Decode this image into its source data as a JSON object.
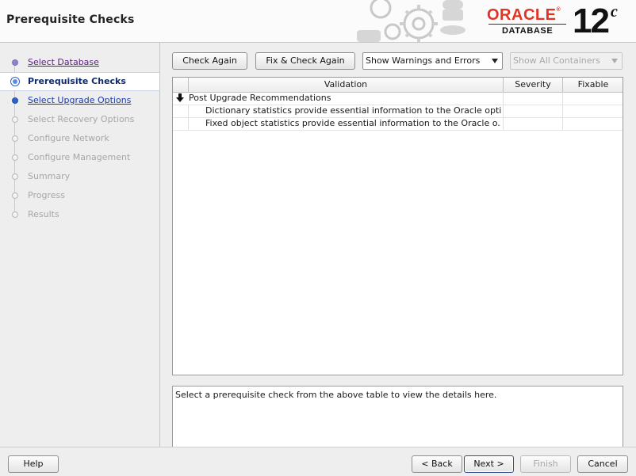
{
  "header": {
    "title": "Prerequisite Checks",
    "logo_brand": "ORACLE",
    "logo_reg": "®",
    "logo_product": "DATABASE",
    "logo_version": "12",
    "logo_version_suffix": "c"
  },
  "sidebar": {
    "items": [
      {
        "label": "Select Database",
        "state": "done"
      },
      {
        "label": "Prerequisite Checks",
        "state": "current"
      },
      {
        "label": "Select Upgrade Options",
        "state": "link"
      },
      {
        "label": "Select Recovery Options",
        "state": "disabled"
      },
      {
        "label": "Configure Network",
        "state": "disabled"
      },
      {
        "label": "Configure Management",
        "state": "disabled"
      },
      {
        "label": "Summary",
        "state": "disabled"
      },
      {
        "label": "Progress",
        "state": "disabled"
      },
      {
        "label": "Results",
        "state": "disabled"
      }
    ]
  },
  "toolbar": {
    "check_again": "Check Again",
    "fix_check_again": "Fix & Check Again",
    "filter_select": "Show Warnings and Errors",
    "containers_select": "Show All Containers"
  },
  "table": {
    "headers": [
      "Validation",
      "Severity",
      "Fixable"
    ],
    "group_label": "Post Upgrade Recommendations",
    "rows": [
      {
        "validation": "Dictionary statistics provide essential information to the Oracle opti...",
        "severity": "",
        "fixable": ""
      },
      {
        "validation": "Fixed object statistics provide essential information to the Oracle o...",
        "severity": "",
        "fixable": ""
      }
    ]
  },
  "details": {
    "text": "Select a prerequisite check from the above table to view the details here."
  },
  "footer": {
    "help": "Help",
    "back": "< Back",
    "next": "Next >",
    "finish": "Finish",
    "cancel": "Cancel"
  },
  "colors": {
    "brand_red": "#e03424",
    "link_blue": "#1a3aa8",
    "visited_purple": "#5a1f7a"
  }
}
